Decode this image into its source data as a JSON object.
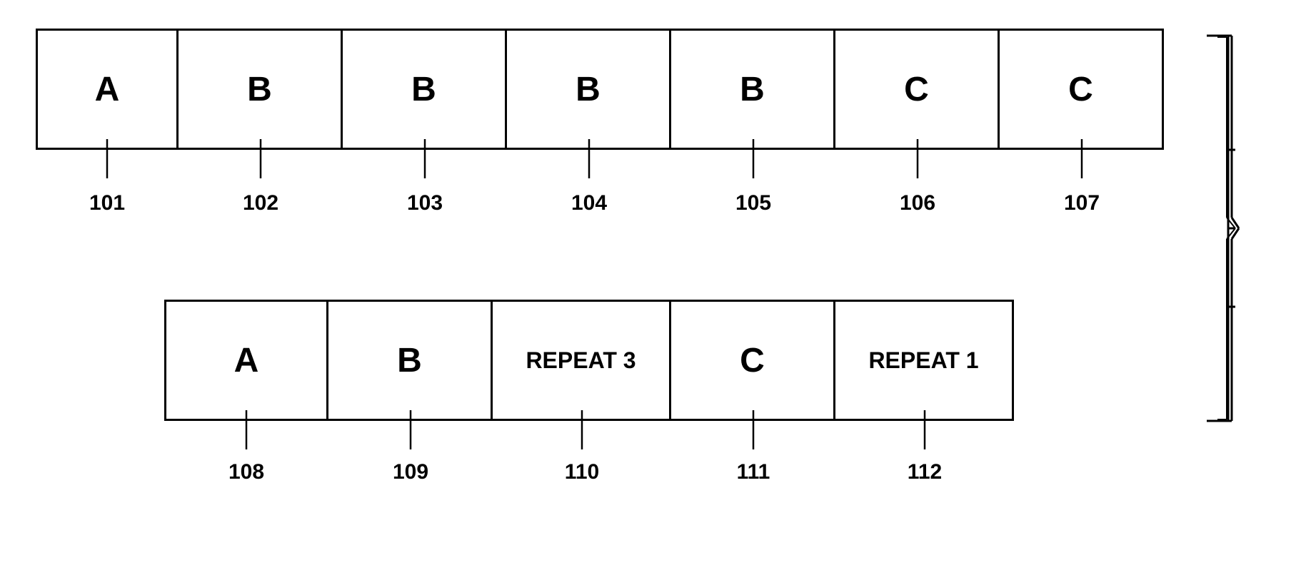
{
  "diagram": {
    "top_row": {
      "cells": [
        {
          "id": "101",
          "label": "A",
          "class": "cell-a-top"
        },
        {
          "id": "102",
          "label": "B",
          "class": "cell-b1"
        },
        {
          "id": "103",
          "label": "B",
          "class": "cell-b2"
        },
        {
          "id": "104",
          "label": "B",
          "class": "cell-b3"
        },
        {
          "id": "105",
          "label": "B",
          "class": "cell-b4"
        },
        {
          "id": "106",
          "label": "C",
          "class": "cell-c1"
        },
        {
          "id": "107",
          "label": "C",
          "class": "cell-c2"
        }
      ]
    },
    "bottom_row": {
      "cells": [
        {
          "id": "108",
          "label": "A",
          "class": "cell-a-bot"
        },
        {
          "id": "109",
          "label": "B",
          "class": "cell-b-bot"
        },
        {
          "id": "110",
          "label": "REPEAT 3",
          "class": "cell-rep3"
        },
        {
          "id": "111",
          "label": "C",
          "class": "cell-c-bot"
        },
        {
          "id": "112",
          "label": "REPEAT 1",
          "class": "cell-rep1"
        }
      ]
    }
  }
}
